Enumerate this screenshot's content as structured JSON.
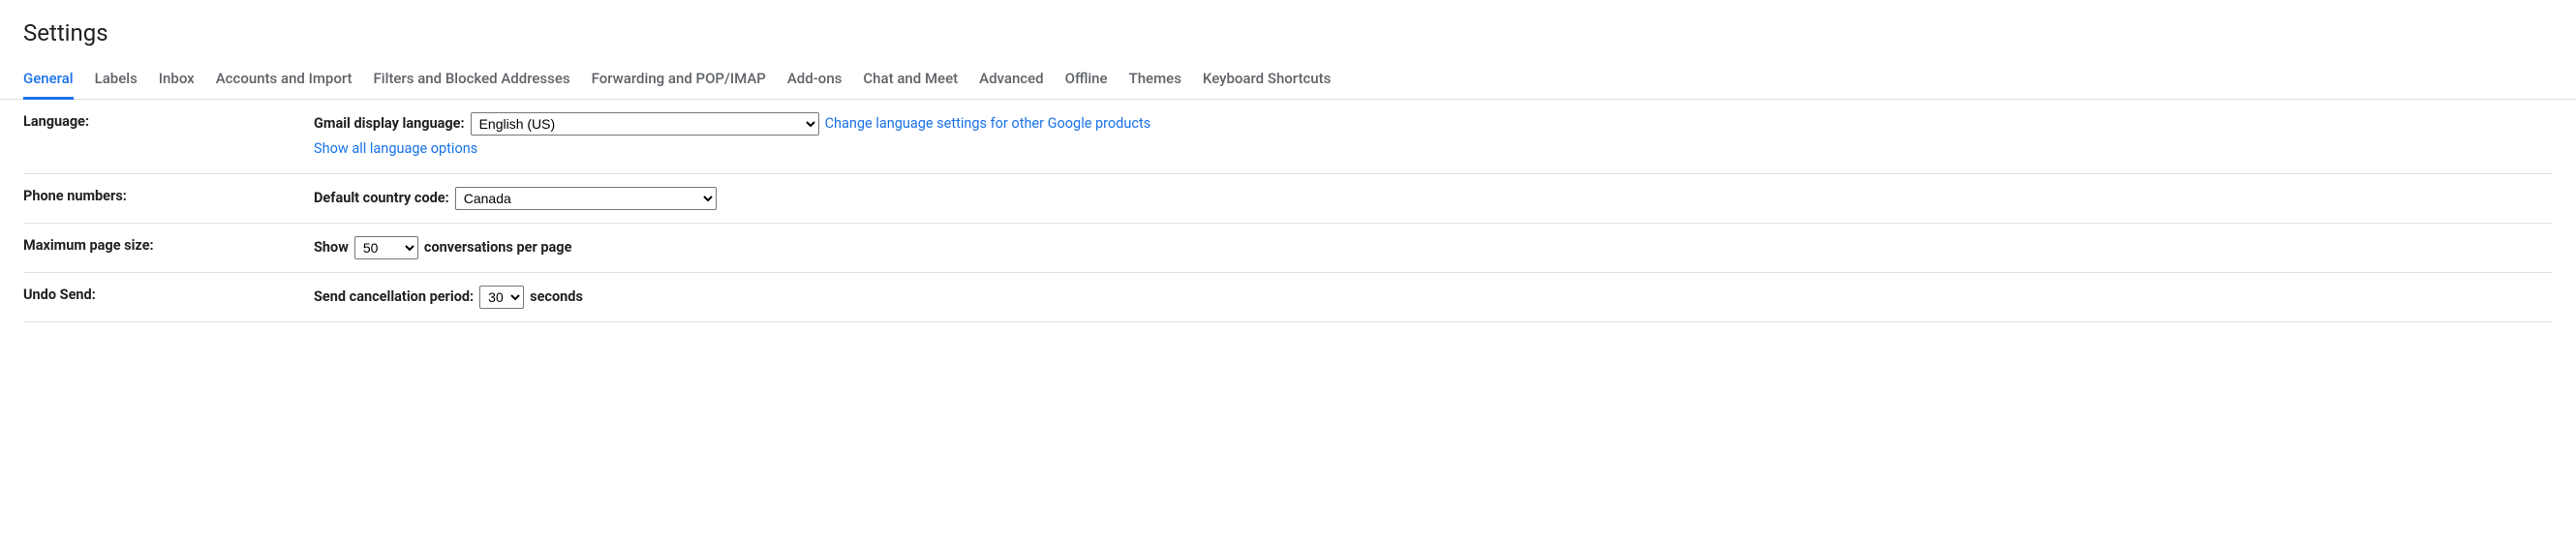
{
  "page_title": "Settings",
  "tabs": [
    "General",
    "Labels",
    "Inbox",
    "Accounts and Import",
    "Filters and Blocked Addresses",
    "Forwarding and POP/IMAP",
    "Add-ons",
    "Chat and Meet",
    "Advanced",
    "Offline",
    "Themes",
    "Keyboard Shortcuts"
  ],
  "active_tab": "General",
  "rows": {
    "language": {
      "label": "Language:",
      "display_language_label": "Gmail display language:",
      "display_language_value": "English (US)",
      "change_link": "Change language settings for other Google products",
      "show_all_link": "Show all language options"
    },
    "phone": {
      "label": "Phone numbers:",
      "country_label": "Default country code:",
      "country_value": "Canada"
    },
    "pagesize": {
      "label": "Maximum page size:",
      "prefix": "Show",
      "value": "50",
      "suffix": "conversations per page"
    },
    "undo": {
      "label": "Undo Send:",
      "prefix": "Send cancellation period:",
      "value": "30",
      "suffix": "seconds"
    }
  }
}
